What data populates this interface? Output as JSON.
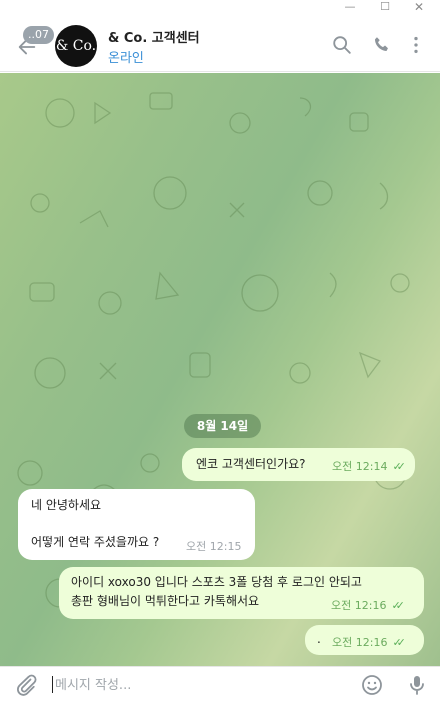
{
  "window": {
    "min_glyph": "—",
    "max_glyph": "☐",
    "close_glyph": "✕"
  },
  "header": {
    "unread_count": "..07",
    "avatar_text": "& Co.",
    "title": "& Co. 고객센터",
    "status": "온라인"
  },
  "chat": {
    "date_chip": "8월 14일",
    "messages": [
      {
        "side": "out",
        "text": "엔코 고객센터인가요?",
        "time": "오전 12:14",
        "read": true
      },
      {
        "side": "in",
        "text_lines": [
          "네 안녕하세요",
          "",
          "어떻게 연락 주셨을까요 ?"
        ],
        "time": "오전 12:15"
      },
      {
        "side": "out",
        "text_lines": [
          "아이디 xoxo30 입니다 스포츠 3폴 당첨 후 로그인 안되고",
          "총판 형배님이 먹튀한다고 카톡해서요"
        ],
        "time": "오전 12:16",
        "read": true
      },
      {
        "side": "out",
        "text": ".",
        "time": "오전 12:16",
        "read": true
      }
    ]
  },
  "composer": {
    "placeholder": "메시지 작성..."
  },
  "colors": {
    "accent": "#3a8fd6",
    "out_bubble": "#eefed9",
    "check": "#5cb05a"
  },
  "icons": [
    "back-arrow-icon",
    "search-icon",
    "phone-icon",
    "more-vertical-icon",
    "paperclip-icon",
    "emoji-icon",
    "microphone-icon"
  ]
}
